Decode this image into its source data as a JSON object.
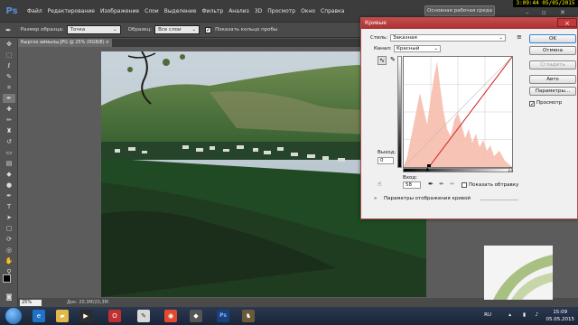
{
  "app": {
    "logo": "Ps"
  },
  "menu": [
    "Файл",
    "Редактирование",
    "Изображение",
    "Слои",
    "Выделение",
    "Фильтр",
    "Анализ",
    "3D",
    "Просмотр",
    "Окно",
    "Справка"
  ],
  "workspace_button": "Основная рабочая среда",
  "clock": "3:09:44  05/05/2015",
  "options": {
    "sample_size_label": "Размер образца:",
    "sample_size_value": "Точка",
    "sample_label": "Образец:",
    "sample_value": "Все слои",
    "show_ring_label": "Показать кольцо пробы"
  },
  "document": {
    "tab_title": "Кыргоо аймылы.JPG @ 25% (RGB/8)",
    "zoom": "25%",
    "doc_info": "Док: 20,3M/20,3M"
  },
  "dialog": {
    "title": "Кривые",
    "preset_label": "Стиль:",
    "preset_value": "Заказная",
    "channel_label": "Канал:",
    "channel_value": "Красный",
    "output_label": "Выход:",
    "output_value": "0",
    "input_label": "Вход:",
    "input_value": "58",
    "show_clipping_label": "Показать обтравку",
    "curve_options_label": "Параметры отображения кривой",
    "buttons": {
      "ok": "OK",
      "cancel": "Отмена",
      "smooth": "Сгладить",
      "auto": "Авто",
      "options": "Параметры...",
      "preview": "Просмотр"
    }
  },
  "taskbar": {
    "lang": "RU",
    "time": "15:09",
    "date": "05.05.2015"
  }
}
